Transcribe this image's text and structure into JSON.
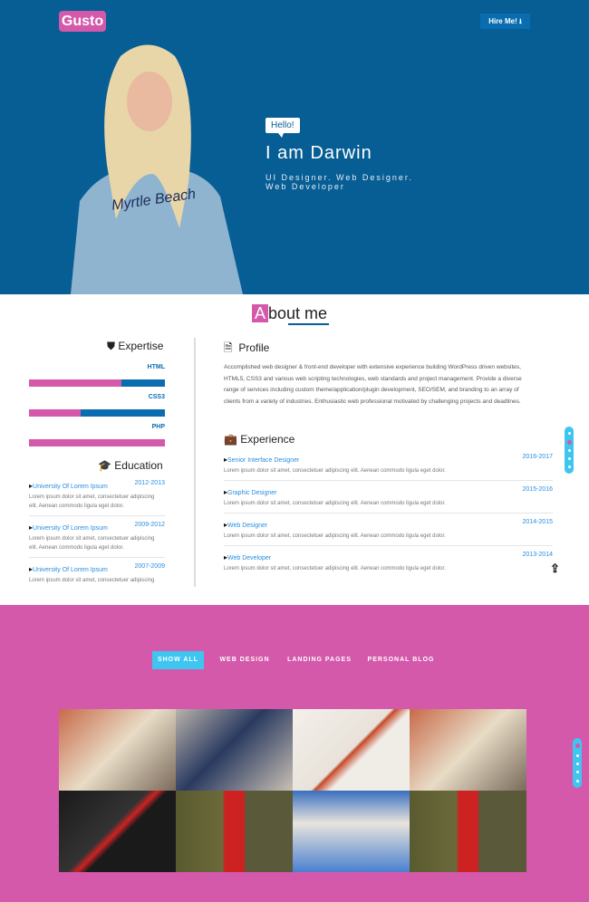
{
  "header": {
    "logo": "Gusto",
    "hire_label": "Hire Me!",
    "hire_icon": "download-icon"
  },
  "hero": {
    "greeting": "Hello!",
    "name": "I am Darwin",
    "role": "UI Designer. Web Designer. Web Developer"
  },
  "about": {
    "title_initial": "A",
    "title_rest": "bout me"
  },
  "expertise": {
    "title": "Expertise",
    "icon": "shield-icon",
    "skills": [
      {
        "name": "HTML",
        "percent": 68
      },
      {
        "name": "CSS3",
        "percent": 38
      },
      {
        "name": "PHP",
        "percent": 100
      }
    ]
  },
  "education": {
    "title": "Education",
    "icon": "graduation-cap-icon",
    "items": [
      {
        "title": "University Of Lorem Ipsum",
        "date": "2012-2013",
        "desc": "Lorem ipsum dolor sit amet, consectetuer adipiscing elit. Aenean commodo ligula eget dolor."
      },
      {
        "title": "University Of Lorem Ipsum",
        "date": "2009-2012",
        "desc": "Lorem ipsum dolor sit amet, consectetuer adipiscing elit. Aenean commodo ligula eget dolor."
      },
      {
        "title": "University Of Lorem Ipsum",
        "date": "2007-2009",
        "desc": "Lorem ipsum dolor sit amet, consectetuer adipiscing"
      }
    ]
  },
  "profile": {
    "title": "Profile",
    "icon": "document-icon",
    "text": "Accomplished web designer & front-end developer with extensive experience building WordPress driven websites, HTML5, CSS3 and various web scripting technologies, web standards and project management. Provide a diverse range of services including custom theme/application/plugin development, SEO/SEM, and branding to an array of clients from a variety of industries. Enthusiastic web professional motivated by challenging projects and deadlines."
  },
  "experience": {
    "title": "Experience",
    "icon": "briefcase-icon",
    "items": [
      {
        "title": "Senior Interface Designer",
        "date": "2016-2017",
        "desc": "Lorem ipsum dolor sit amet, consectetuer adipiscing elit. Aenean commodo ligula eget dolor."
      },
      {
        "title": "Graphic Designer",
        "date": "2015-2016",
        "desc": "Lorem ipsum dolor sit amet, consectetuer adipiscing elit. Aenean commodo ligula eget dolor."
      },
      {
        "title": "Web Designer",
        "date": "2014-2015",
        "desc": "Lorem ipsum dolor sit amet, consectetuer adipiscing elit. Aenean commodo ligula eget dolor."
      },
      {
        "title": "Web Developer",
        "date": "2013-2014",
        "desc": "Lorem ipsum dolor sit amet, consectetuer adipiscing elit. Aenean commodo ligula eget dolor."
      }
    ]
  },
  "portfolio": {
    "filters": [
      "SHOW ALL",
      "WEB DESIGN",
      "LANDING PAGES",
      "PERSONAL BLOG"
    ],
    "active_filter": "SHOW ALL",
    "tiles": [
      "backpack",
      "calculator",
      "maple-leaf-notebook",
      "backpack",
      "red-pencils",
      "phone-booth",
      "teddy-bear",
      "phone-booth"
    ]
  },
  "colors": {
    "primary": "#075e95",
    "accent": "#d459aa",
    "cyan": "#3ec6f0"
  }
}
